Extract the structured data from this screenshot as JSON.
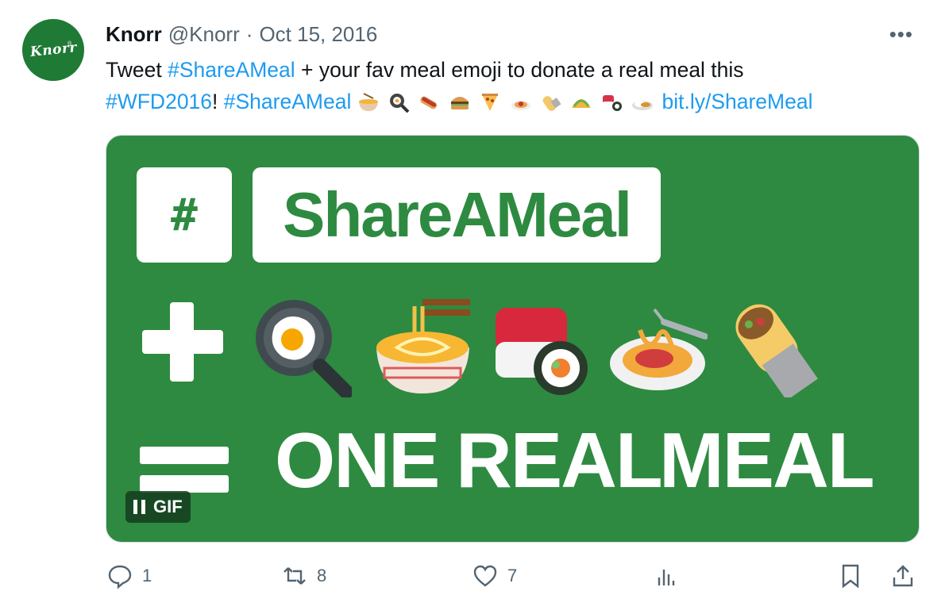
{
  "author": {
    "avatar_text": "Knorr",
    "avatar_mark": "®",
    "name": "Knorr",
    "handle": "@Knorr",
    "separator": "·",
    "date": "Oct 15, 2016"
  },
  "tweet": {
    "text_1": "Tweet ",
    "hashtag_1": "#ShareAMeal",
    "text_2": " + your fav meal emoji to donate a real meal this ",
    "hashtag_2": "#WFD2016",
    "text_3": "! ",
    "hashtag_3": "#ShareAMeal",
    "link": "bit.ly/ShareMeal",
    "emojis": [
      "ramen-icon",
      "egg-pan-icon",
      "hotdog-icon",
      "burger-icon",
      "pizza-icon",
      "spaghetti-icon",
      "burrito-icon",
      "taco-icon",
      "sushi-icon",
      "curry-rice-icon"
    ]
  },
  "media": {
    "hash_symbol": "#",
    "hashtag_word": "ShareAMeal",
    "word_1": "ONE",
    "word_2": "REAL",
    "word_3": "MEAL",
    "gif_label": "GIF",
    "background_color": "#2e8a40",
    "food_icons": [
      "egg-pan-icon",
      "ramen-icon",
      "sushi-icon",
      "spaghetti-icon",
      "burrito-icon"
    ]
  },
  "actions": {
    "reply_count": "1",
    "retweet_count": "8",
    "like_count": "7",
    "more_label": "•••"
  },
  "colors": {
    "link": "#1d9bf0",
    "muted": "#536471",
    "brand_green": "#1e7a34"
  }
}
